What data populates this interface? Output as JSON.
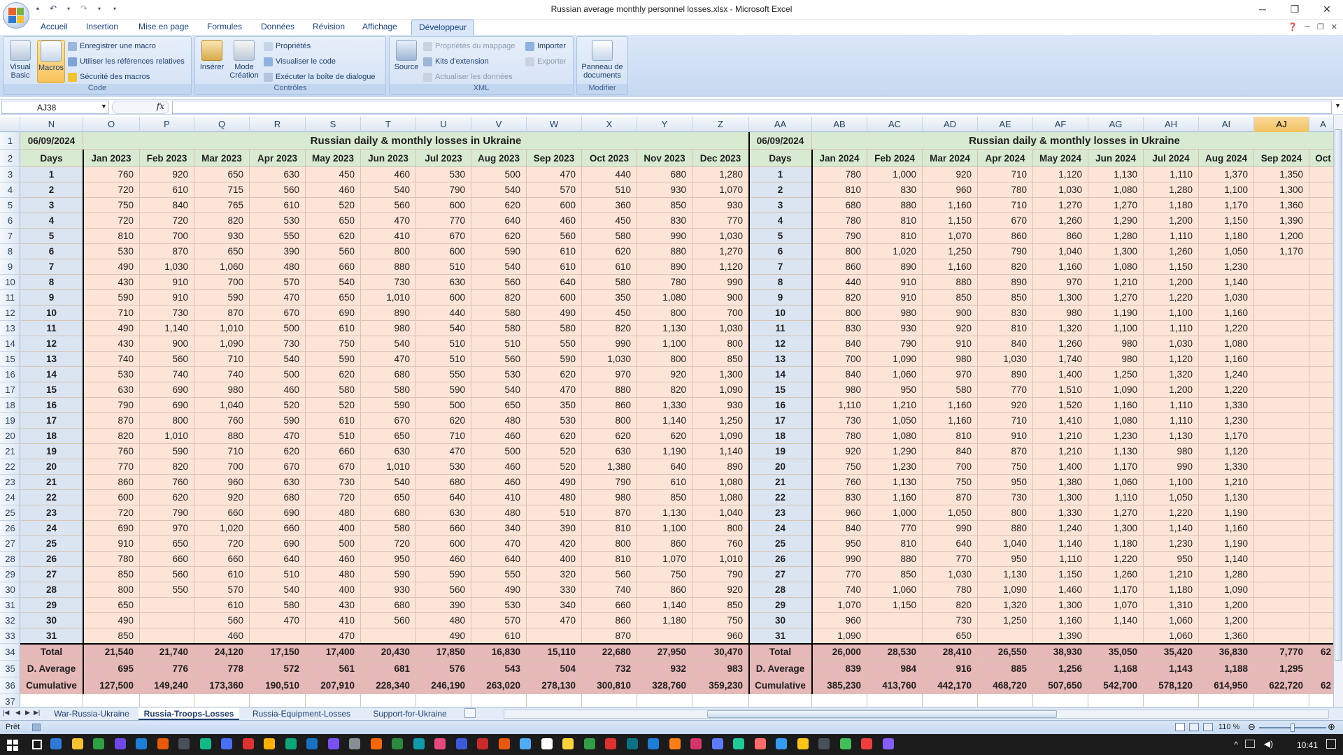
{
  "window": {
    "title": "Russian average monthly personnel losses.xlsx - Microsoft Excel",
    "minimize": "─",
    "restore": "❐",
    "close": "✕"
  },
  "ribbon_tabs": [
    "Accueil",
    "Insertion",
    "Mise en page",
    "Formules",
    "Données",
    "Révision",
    "Affichage",
    "Développeur"
  ],
  "active_tab": "Développeur",
  "ribbon": {
    "code": {
      "label": "Code",
      "visual_basic": "Visual Basic",
      "macros": "Macros",
      "record": "Enregistrer une macro",
      "relative": "Utiliser les références relatives",
      "security": "Sécurité des macros"
    },
    "controls": {
      "label": "Contrôles",
      "insert": "Insérer",
      "design_mode": "Mode Création",
      "properties": "Propriétés",
      "view_code": "Visualiser le code",
      "run_dialog": "Exécuter la boîte de dialogue"
    },
    "xml": {
      "label": "XML",
      "source": "Source",
      "map_props": "Propriétés du mappage",
      "expansion": "Kits d'extension",
      "refresh": "Actualiser les données",
      "import": "Importer",
      "export": "Exporter"
    },
    "modify": {
      "label": "Modifier",
      "doc_panel": "Panneau de documents"
    }
  },
  "formula_bar": {
    "name_box": "AJ38",
    "fx": "fx",
    "content": ""
  },
  "columns": [
    "N",
    "O",
    "P",
    "Q",
    "R",
    "S",
    "T",
    "U",
    "V",
    "W",
    "X",
    "Y",
    "Z",
    "AA",
    "AB",
    "AC",
    "AD",
    "AE",
    "AF",
    "AG",
    "AH",
    "AI",
    "AJ",
    "A"
  ],
  "selected_column": "AJ",
  "row_numbers": [
    "1",
    "2",
    "3",
    "4",
    "5",
    "6",
    "7",
    "8",
    "9",
    "10",
    "11",
    "12",
    "13",
    "14",
    "15",
    "16",
    "17",
    "18",
    "19",
    "20",
    "21",
    "22",
    "23",
    "24",
    "25",
    "26",
    "27",
    "28",
    "29",
    "30",
    "31",
    "32",
    "33",
    "34",
    "35",
    "36",
    "37"
  ],
  "left_block": {
    "date": "06/09/2024",
    "title": "Russian daily & monthly losses in Ukraine",
    "days_header": "Days",
    "months": [
      "Jan 2023",
      "Feb 2023",
      "Mar 2023",
      "Apr 2023",
      "May 2023",
      "Jun 2023",
      "Jul 2023",
      "Aug 2023",
      "Sep 2023",
      "Oct 2023",
      "Nov 2023",
      "Dec 2023"
    ],
    "rows": [
      [
        "760",
        "920",
        "650",
        "630",
        "450",
        "460",
        "530",
        "500",
        "470",
        "440",
        "680",
        "1,280"
      ],
      [
        "720",
        "610",
        "715",
        "560",
        "460",
        "540",
        "790",
        "540",
        "570",
        "510",
        "930",
        "1,070"
      ],
      [
        "750",
        "840",
        "765",
        "610",
        "520",
        "560",
        "600",
        "620",
        "600",
        "360",
        "850",
        "930"
      ],
      [
        "720",
        "720",
        "820",
        "530",
        "650",
        "470",
        "770",
        "640",
        "460",
        "450",
        "830",
        "770"
      ],
      [
        "810",
        "700",
        "930",
        "550",
        "620",
        "410",
        "670",
        "620",
        "560",
        "580",
        "990",
        "1,030"
      ],
      [
        "530",
        "870",
        "650",
        "390",
        "560",
        "800",
        "600",
        "590",
        "610",
        "620",
        "880",
        "1,270"
      ],
      [
        "490",
        "1,030",
        "1,060",
        "480",
        "660",
        "880",
        "510",
        "540",
        "610",
        "610",
        "890",
        "1,120"
      ],
      [
        "430",
        "910",
        "700",
        "570",
        "540",
        "730",
        "630",
        "560",
        "640",
        "580",
        "780",
        "990"
      ],
      [
        "590",
        "910",
        "590",
        "470",
        "650",
        "1,010",
        "600",
        "820",
        "600",
        "350",
        "1,080",
        "900"
      ],
      [
        "710",
        "730",
        "870",
        "670",
        "690",
        "890",
        "440",
        "580",
        "490",
        "450",
        "800",
        "700"
      ],
      [
        "490",
        "1,140",
        "1,010",
        "500",
        "610",
        "980",
        "540",
        "580",
        "580",
        "820",
        "1,130",
        "1,030"
      ],
      [
        "430",
        "900",
        "1,090",
        "730",
        "750",
        "540",
        "510",
        "510",
        "550",
        "990",
        "1,100",
        "800"
      ],
      [
        "740",
        "560",
        "710",
        "540",
        "590",
        "470",
        "510",
        "560",
        "590",
        "1,030",
        "800",
        "850"
      ],
      [
        "530",
        "740",
        "740",
        "500",
        "620",
        "680",
        "550",
        "530",
        "620",
        "970",
        "920",
        "1,300"
      ],
      [
        "630",
        "690",
        "980",
        "460",
        "580",
        "580",
        "590",
        "540",
        "470",
        "880",
        "820",
        "1,090"
      ],
      [
        "790",
        "690",
        "1,040",
        "520",
        "520",
        "590",
        "500",
        "650",
        "350",
        "860",
        "1,330",
        "930"
      ],
      [
        "870",
        "800",
        "760",
        "590",
        "610",
        "670",
        "620",
        "480",
        "530",
        "800",
        "1,140",
        "1,250"
      ],
      [
        "820",
        "1,010",
        "880",
        "470",
        "510",
        "650",
        "710",
        "460",
        "620",
        "620",
        "620",
        "1,090"
      ],
      [
        "760",
        "590",
        "710",
        "620",
        "660",
        "630",
        "470",
        "500",
        "520",
        "630",
        "1,190",
        "1,140"
      ],
      [
        "770",
        "820",
        "700",
        "670",
        "670",
        "1,010",
        "530",
        "460",
        "520",
        "1,380",
        "640",
        "890"
      ],
      [
        "860",
        "760",
        "960",
        "630",
        "730",
        "540",
        "680",
        "460",
        "490",
        "790",
        "610",
        "1,080"
      ],
      [
        "600",
        "620",
        "920",
        "680",
        "720",
        "650",
        "640",
        "410",
        "480",
        "980",
        "850",
        "1,080"
      ],
      [
        "720",
        "790",
        "660",
        "690",
        "480",
        "680",
        "630",
        "480",
        "510",
        "870",
        "1,130",
        "1,040"
      ],
      [
        "690",
        "970",
        "1,020",
        "660",
        "400",
        "580",
        "660",
        "340",
        "390",
        "810",
        "1,100",
        "800"
      ],
      [
        "910",
        "650",
        "720",
        "690",
        "500",
        "720",
        "600",
        "470",
        "420",
        "800",
        "860",
        "760"
      ],
      [
        "780",
        "660",
        "660",
        "640",
        "460",
        "950",
        "460",
        "640",
        "400",
        "810",
        "1,070",
        "1,010"
      ],
      [
        "850",
        "560",
        "610",
        "510",
        "480",
        "590",
        "590",
        "550",
        "320",
        "560",
        "750",
        "790"
      ],
      [
        "800",
        "550",
        "570",
        "540",
        "400",
        "930",
        "560",
        "490",
        "330",
        "740",
        "860",
        "920"
      ],
      [
        "650",
        "",
        "610",
        "580",
        "430",
        "680",
        "390",
        "530",
        "340",
        "660",
        "1,140",
        "850"
      ],
      [
        "490",
        "",
        "560",
        "470",
        "410",
        "560",
        "480",
        "570",
        "470",
        "860",
        "1,180",
        "750"
      ],
      [
        "850",
        "",
        "460",
        "",
        "470",
        "",
        "490",
        "610",
        "",
        "870",
        "",
        "960"
      ]
    ],
    "total_label": "Total",
    "totals": [
      "21,540",
      "21,740",
      "24,120",
      "17,150",
      "17,400",
      "20,430",
      "17,850",
      "16,830",
      "15,110",
      "22,680",
      "27,950",
      "30,470"
    ],
    "avg_label": "D. Average",
    "averages": [
      "695",
      "776",
      "778",
      "572",
      "561",
      "681",
      "576",
      "543",
      "504",
      "732",
      "932",
      "983"
    ],
    "cum_label": "Cumulative",
    "cumulative": [
      "127,500",
      "149,240",
      "173,360",
      "190,510",
      "207,910",
      "228,340",
      "246,190",
      "263,020",
      "278,130",
      "300,810",
      "328,760",
      "359,230"
    ]
  },
  "right_block": {
    "date": "06/09/2024",
    "title": "Russian daily & monthly losses in Ukraine",
    "days_header": "Days",
    "months": [
      "Jan 2024",
      "Feb 2024",
      "Mar 2024",
      "Apr 2024",
      "May 2024",
      "Jun 2024",
      "Jul 2024",
      "Aug 2024",
      "Sep 2024",
      "Oct"
    ],
    "rows": [
      [
        "780",
        "1,000",
        "920",
        "710",
        "1,120",
        "1,130",
        "1,110",
        "1,370",
        "1,350"
      ],
      [
        "810",
        "830",
        "960",
        "780",
        "1,030",
        "1,080",
        "1,280",
        "1,100",
        "1,300"
      ],
      [
        "680",
        "880",
        "1,160",
        "710",
        "1,270",
        "1,270",
        "1,180",
        "1,170",
        "1,360"
      ],
      [
        "780",
        "810",
        "1,150",
        "670",
        "1,260",
        "1,290",
        "1,200",
        "1,150",
        "1,390"
      ],
      [
        "790",
        "810",
        "1,070",
        "860",
        "860",
        "1,280",
        "1,110",
        "1,180",
        "1,200"
      ],
      [
        "800",
        "1,020",
        "1,250",
        "790",
        "1,040",
        "1,300",
        "1,260",
        "1,050",
        "1,170"
      ],
      [
        "860",
        "890",
        "1,160",
        "820",
        "1,160",
        "1,080",
        "1,150",
        "1,230",
        ""
      ],
      [
        "440",
        "910",
        "880",
        "890",
        "970",
        "1,210",
        "1,200",
        "1,140",
        ""
      ],
      [
        "820",
        "910",
        "850",
        "850",
        "1,300",
        "1,270",
        "1,220",
        "1,030",
        ""
      ],
      [
        "800",
        "980",
        "900",
        "830",
        "980",
        "1,190",
        "1,100",
        "1,160",
        ""
      ],
      [
        "830",
        "930",
        "920",
        "810",
        "1,320",
        "1,100",
        "1,110",
        "1,220",
        ""
      ],
      [
        "840",
        "790",
        "910",
        "840",
        "1,260",
        "980",
        "1,030",
        "1,080",
        ""
      ],
      [
        "700",
        "1,090",
        "980",
        "1,030",
        "1,740",
        "980",
        "1,120",
        "1,160",
        ""
      ],
      [
        "840",
        "1,060",
        "970",
        "890",
        "1,400",
        "1,250",
        "1,320",
        "1,240",
        ""
      ],
      [
        "980",
        "950",
        "580",
        "770",
        "1,510",
        "1,090",
        "1,200",
        "1,220",
        ""
      ],
      [
        "1,110",
        "1,210",
        "1,160",
        "920",
        "1,520",
        "1,160",
        "1,110",
        "1,330",
        ""
      ],
      [
        "730",
        "1,050",
        "1,160",
        "710",
        "1,410",
        "1,080",
        "1,110",
        "1,230",
        ""
      ],
      [
        "780",
        "1,080",
        "810",
        "910",
        "1,210",
        "1,230",
        "1,130",
        "1,170",
        ""
      ],
      [
        "920",
        "1,290",
        "840",
        "870",
        "1,210",
        "1,130",
        "980",
        "1,120",
        ""
      ],
      [
        "750",
        "1,230",
        "700",
        "750",
        "1,400",
        "1,170",
        "990",
        "1,330",
        ""
      ],
      [
        "760",
        "1,130",
        "750",
        "950",
        "1,380",
        "1,060",
        "1,100",
        "1,210",
        ""
      ],
      [
        "830",
        "1,160",
        "870",
        "730",
        "1,300",
        "1,110",
        "1,050",
        "1,130",
        ""
      ],
      [
        "960",
        "1,000",
        "1,050",
        "800",
        "1,330",
        "1,270",
        "1,220",
        "1,190",
        ""
      ],
      [
        "840",
        "770",
        "990",
        "880",
        "1,240",
        "1,300",
        "1,140",
        "1,160",
        ""
      ],
      [
        "950",
        "810",
        "640",
        "1,040",
        "1,140",
        "1,180",
        "1,230",
        "1,190",
        ""
      ],
      [
        "990",
        "880",
        "770",
        "950",
        "1,110",
        "1,220",
        "950",
        "1,140",
        ""
      ],
      [
        "770",
        "850",
        "1,030",
        "1,130",
        "1,150",
        "1,260",
        "1,210",
        "1,280",
        ""
      ],
      [
        "740",
        "1,060",
        "780",
        "1,090",
        "1,460",
        "1,170",
        "1,180",
        "1,090",
        ""
      ],
      [
        "1,070",
        "1,150",
        "820",
        "1,320",
        "1,300",
        "1,070",
        "1,310",
        "1,200",
        ""
      ],
      [
        "960",
        "",
        "730",
        "1,250",
        "1,160",
        "1,140",
        "1,060",
        "1,200",
        ""
      ],
      [
        "1,090",
        "",
        "650",
        "",
        "1,390",
        "",
        "1,060",
        "1,360",
        ""
      ]
    ],
    "total_label": "Total",
    "totals": [
      "26,000",
      "28,530",
      "28,410",
      "26,550",
      "38,930",
      "35,050",
      "35,420",
      "36,830",
      "7,770",
      "62"
    ],
    "avg_label": "D. Average",
    "averages": [
      "839",
      "984",
      "916",
      "885",
      "1,256",
      "1,168",
      "1,143",
      "1,188",
      "1,295"
    ],
    "cum_label": "Cumulative",
    "cumulative": [
      "385,230",
      "413,760",
      "442,170",
      "468,720",
      "507,650",
      "542,700",
      "578,120",
      "614,950",
      "622,720",
      "62"
    ]
  },
  "sheet_tabs": [
    "War-Russia-Ukraine",
    "Russia-Troops-Losses",
    "Russia-Equipment-Losses",
    "Support-for-Ukraine"
  ],
  "active_sheet": "Russia-Troops-Losses",
  "status": {
    "mode": "Prêt",
    "zoom": "110 %"
  },
  "taskbar": {
    "time": "10:41"
  },
  "colors": {
    "header_green": "#d9ead3",
    "day_blue": "#dbe5f1",
    "body_peach": "#fce4d6",
    "total_pink": "#e6b8b7"
  }
}
